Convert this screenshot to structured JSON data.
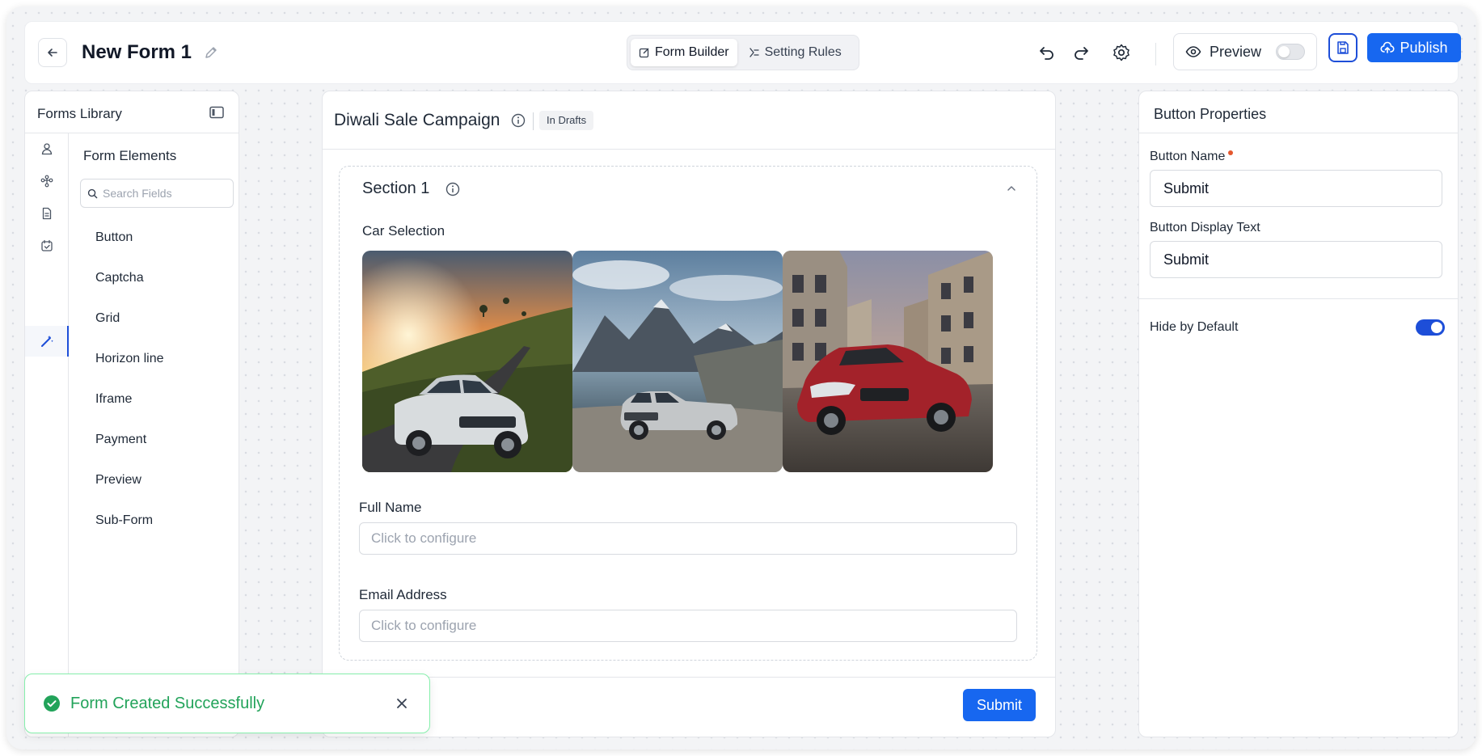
{
  "header": {
    "title": "New Form 1",
    "tabs": [
      {
        "label": "Form Builder",
        "active": true
      },
      {
        "label": "Setting Rules",
        "active": false
      }
    ],
    "preview_label": "Preview",
    "preview_enabled": false,
    "publish_label": "Publish"
  },
  "library": {
    "title": "Forms Library",
    "section_title": "Form Elements",
    "search_placeholder": "Search Fields",
    "rail_icons": [
      "user-icon",
      "flow-icon",
      "document-icon",
      "calendar-check-icon",
      "magic-wand-icon"
    ],
    "elements": [
      "Button",
      "Captcha",
      "Grid",
      "Horizon line",
      "Iframe",
      "Payment",
      "Preview",
      "Sub-Form"
    ]
  },
  "canvas": {
    "title": "Diwali Sale Campaign",
    "status_badge": "In Drafts",
    "section": {
      "title": "Section 1",
      "car_label": "Car Selection",
      "cars": [
        {
          "name": "white-compact-suv-hill-road-sunset"
        },
        {
          "name": "silver-suv-mountain-lake"
        },
        {
          "name": "red-sedan-cobblestone-street"
        }
      ],
      "full_name_label": "Full Name",
      "full_name_placeholder": "Click to configure",
      "email_label": "Email Address",
      "email_placeholder": "Click to configure"
    },
    "submit_label": "Submit"
  },
  "properties": {
    "title": "Button Properties",
    "button_name_label": "Button Name",
    "button_name_value": "Submit",
    "display_text_label": "Button Display Text",
    "display_text_value": "Submit",
    "hide_default_label": "Hide by Default",
    "hide_default_enabled": true
  },
  "toast": {
    "message": "Form Created Successfully"
  },
  "colors": {
    "accent": "#1767f0",
    "success": "#22a35a",
    "required": "#e4572e"
  }
}
